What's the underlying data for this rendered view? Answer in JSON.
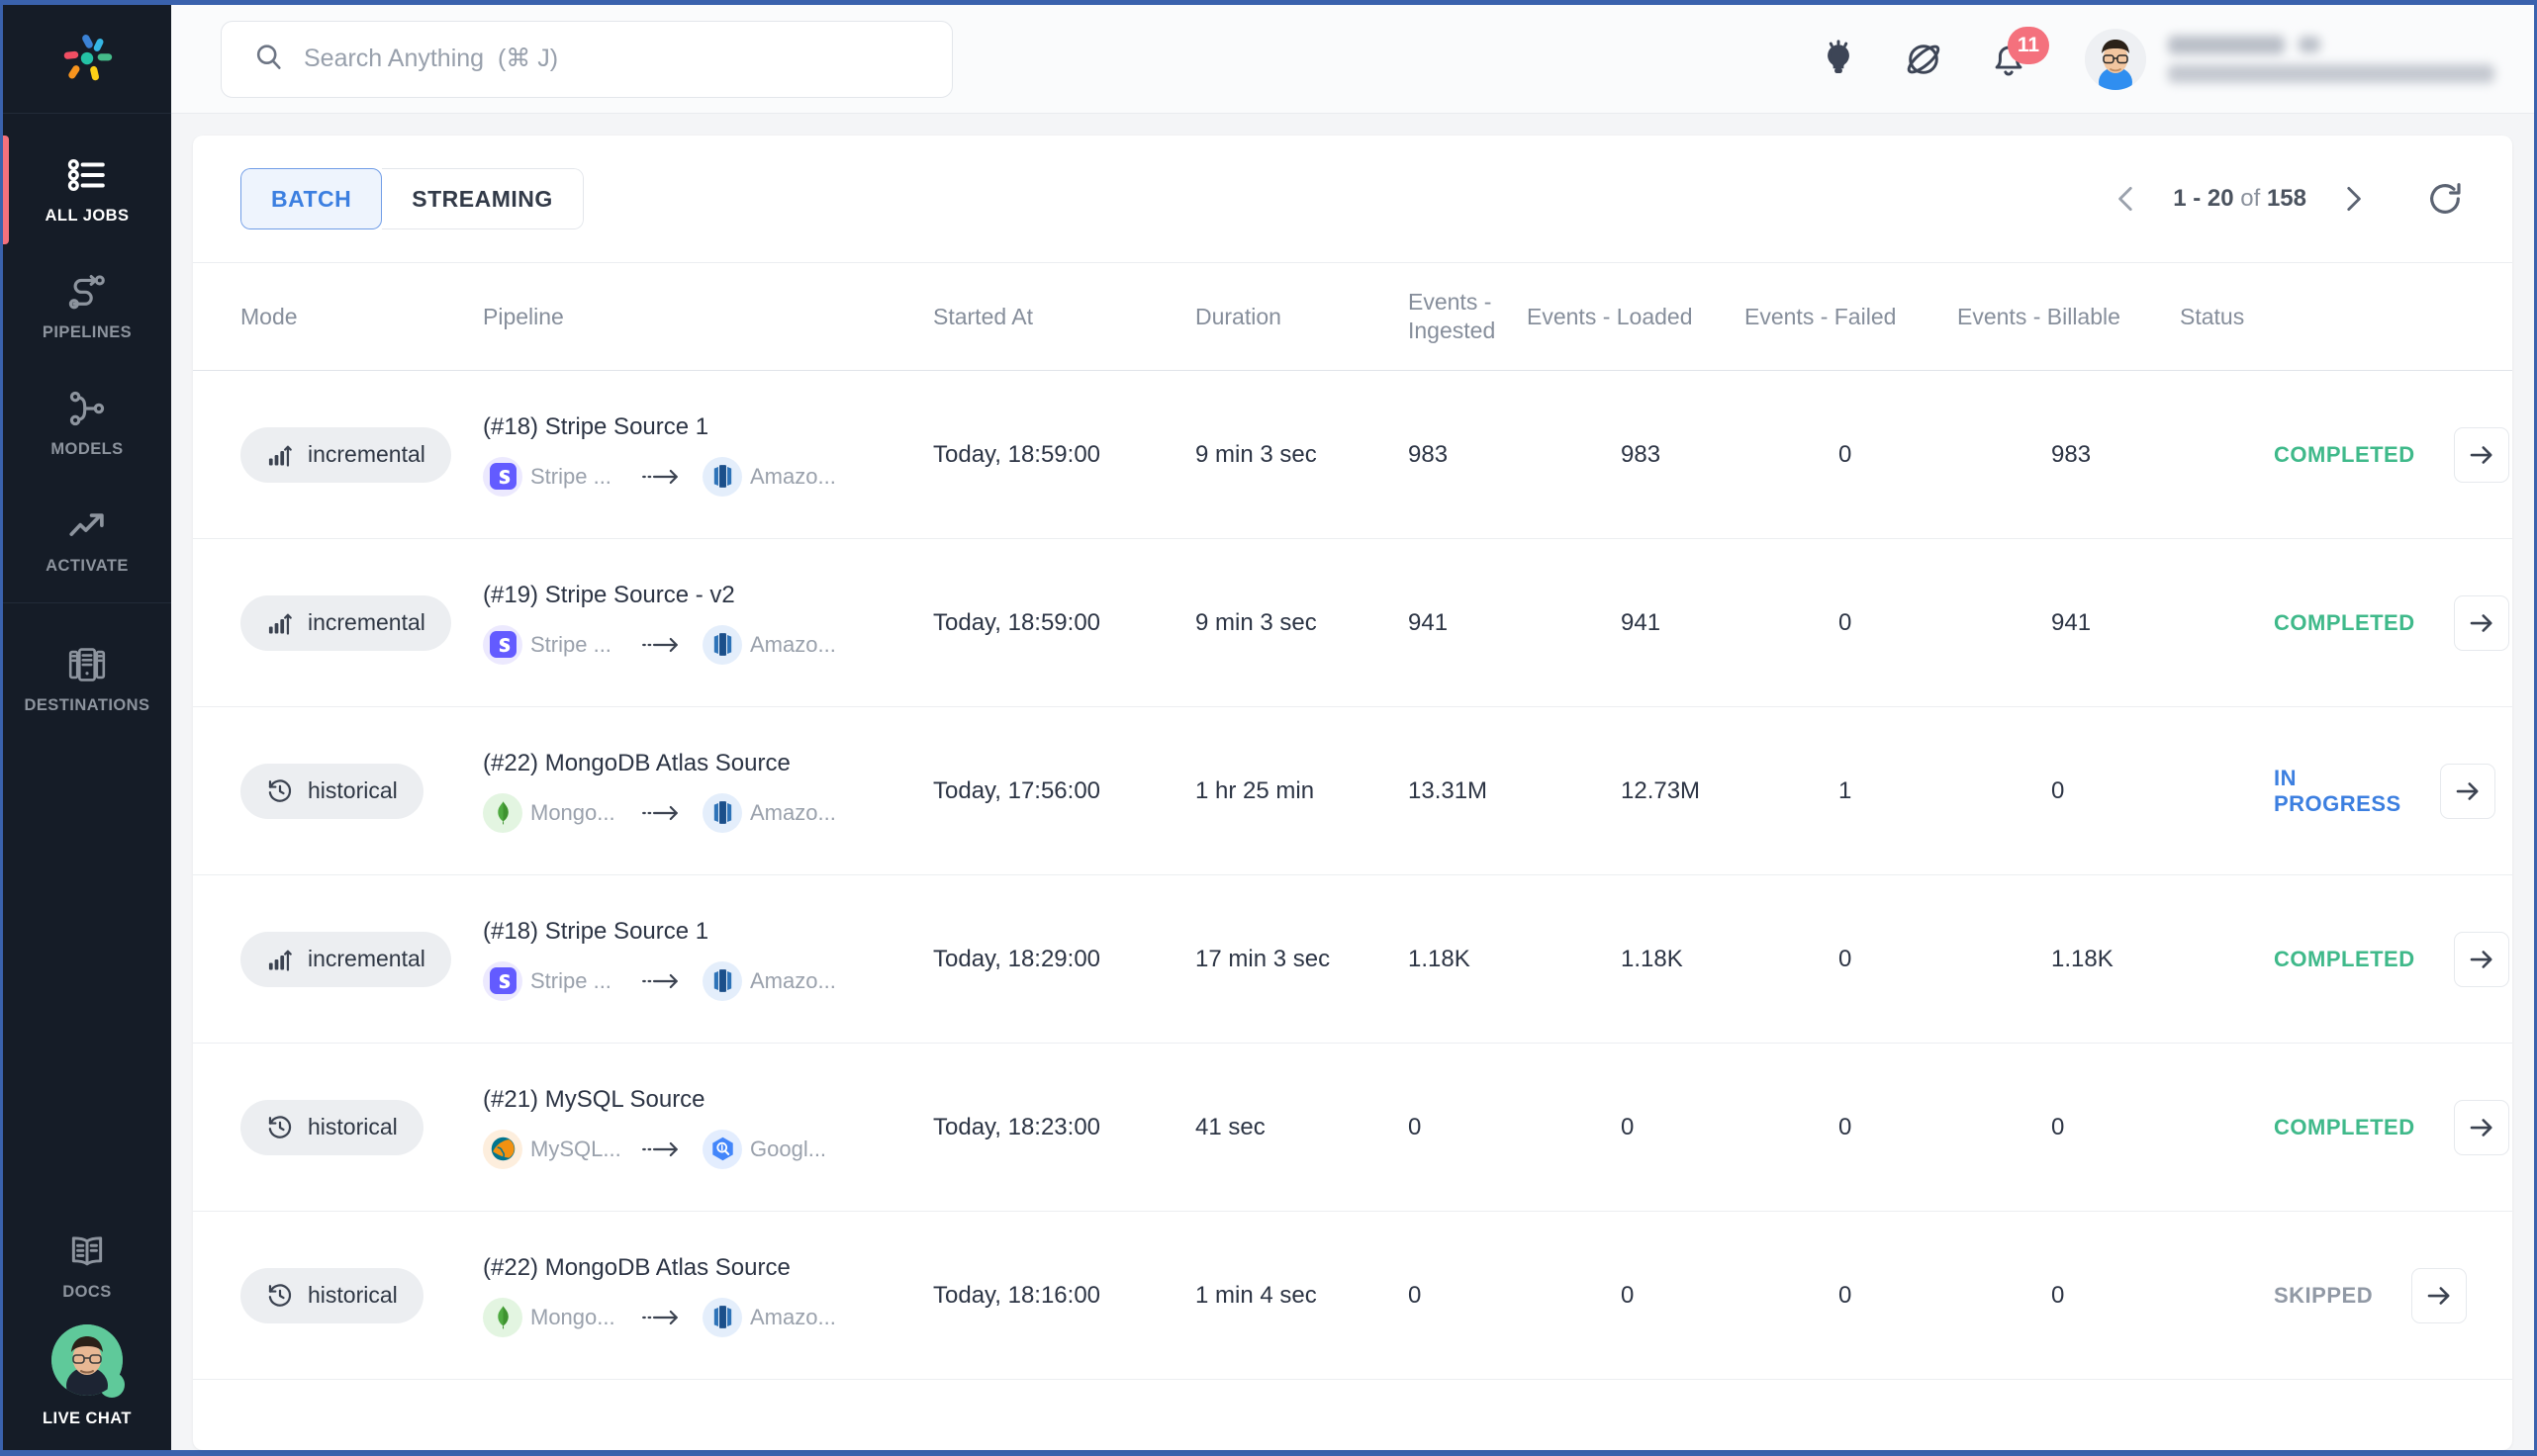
{
  "sidebar": {
    "logo_name": "hevo-logo",
    "items": [
      {
        "label": "ALL JOBS",
        "icon": "list-icon",
        "active": true
      },
      {
        "label": "PIPELINES",
        "icon": "pipeline-icon",
        "active": false
      },
      {
        "label": "MODELS",
        "icon": "models-icon",
        "active": false
      },
      {
        "label": "ACTIVATE",
        "icon": "trending-up-icon",
        "active": false
      },
      {
        "label": "DESTINATIONS",
        "icon": "server-rack-icon",
        "active": false
      },
      {
        "label": "DOCS",
        "icon": "book-icon",
        "active": false
      }
    ],
    "live_chat_label": "LIVE CHAT"
  },
  "topbar": {
    "search_placeholder": "Search Anything  (⌘ J)",
    "search_value": "",
    "icons": [
      {
        "name": "lightbulb-icon"
      },
      {
        "name": "planet-icon"
      },
      {
        "name": "bell-icon",
        "badge": "11"
      }
    ],
    "notification_count": "11",
    "user": {
      "name_redacted": true,
      "email_redacted": true
    }
  },
  "toolbar": {
    "tabs": [
      {
        "label": "BATCH",
        "selected": true
      },
      {
        "label": "STREAMING",
        "selected": false
      }
    ],
    "pagination": {
      "range": "1 - 20",
      "of_label": "of",
      "total": "158"
    },
    "refresh_label": "refresh-icon"
  },
  "table": {
    "columns": [
      {
        "key": "mode",
        "label": "Mode"
      },
      {
        "key": "pipeline",
        "label": "Pipeline"
      },
      {
        "key": "started",
        "label": "Started At"
      },
      {
        "key": "duration",
        "label": "Duration"
      },
      {
        "key": "ingested",
        "label": "Events - Ingested"
      },
      {
        "key": "loaded",
        "label": "Events - Loaded"
      },
      {
        "key": "failed",
        "label": "Events - Failed"
      },
      {
        "key": "billable",
        "label": "Events - Billable"
      },
      {
        "key": "status",
        "label": "Status"
      }
    ],
    "rows": [
      {
        "mode": "incremental",
        "mode_icon": "bar-chart-up-icon",
        "pipeline": "(#18) Stripe Source 1",
        "source": "Stripe ...",
        "source_icon": "stripe-icon",
        "destination": "Amazo...",
        "destination_icon": "amazon-redshift-icon",
        "started": "Today, 18:59:00",
        "duration": "9 min 3 sec",
        "ingested": "983",
        "loaded": "983",
        "failed": "0",
        "billable": "983",
        "status": "COMPLETED",
        "status_kind": "completed"
      },
      {
        "mode": "incremental",
        "mode_icon": "bar-chart-up-icon",
        "pipeline": "(#19) Stripe Source - v2",
        "source": "Stripe ...",
        "source_icon": "stripe-icon",
        "destination": "Amazo...",
        "destination_icon": "amazon-redshift-icon",
        "started": "Today, 18:59:00",
        "duration": "9 min 3 sec",
        "ingested": "941",
        "loaded": "941",
        "failed": "0",
        "billable": "941",
        "status": "COMPLETED",
        "status_kind": "completed"
      },
      {
        "mode": "historical",
        "mode_icon": "history-clock-icon",
        "pipeline": "(#22) MongoDB Atlas Source",
        "source": "Mongo...",
        "source_icon": "mongodb-icon",
        "destination": "Amazo...",
        "destination_icon": "amazon-redshift-icon",
        "started": "Today, 17:56:00",
        "duration": "1 hr 25 min",
        "ingested": "13.31M",
        "loaded": "12.73M",
        "failed": "1",
        "billable": "0",
        "status": "IN PROGRESS",
        "status_kind": "inprogress"
      },
      {
        "mode": "incremental",
        "mode_icon": "bar-chart-up-icon",
        "pipeline": "(#18) Stripe Source 1",
        "source": "Stripe ...",
        "source_icon": "stripe-icon",
        "destination": "Amazo...",
        "destination_icon": "amazon-redshift-icon",
        "started": "Today, 18:29:00",
        "duration": "17 min 3 sec",
        "ingested": "1.18K",
        "loaded": "1.18K",
        "failed": "0",
        "billable": "1.18K",
        "status": "COMPLETED",
        "status_kind": "completed"
      },
      {
        "mode": "historical",
        "mode_icon": "history-clock-icon",
        "pipeline": "(#21) MySQL Source",
        "source": "MySQL...",
        "source_icon": "mysql-icon",
        "destination": "Googl...",
        "destination_icon": "google-bigquery-icon",
        "started": "Today, 18:23:00",
        "duration": "41 sec",
        "ingested": "0",
        "loaded": "0",
        "failed": "0",
        "billable": "0",
        "status": "COMPLETED",
        "status_kind": "completed"
      },
      {
        "mode": "historical",
        "mode_icon": "history-clock-icon",
        "pipeline": "(#22) MongoDB Atlas Source",
        "source": "Mongo...",
        "source_icon": "mongodb-icon",
        "destination": "Amazo...",
        "destination_icon": "amazon-redshift-icon",
        "started": "Today, 18:16:00",
        "duration": "1 min 4 sec",
        "ingested": "0",
        "loaded": "0",
        "failed": "0",
        "billable": "0",
        "status": "SKIPPED",
        "status_kind": "skipped"
      }
    ]
  },
  "colors": {
    "sidebar_bg": "#151c27",
    "active_marker": "#f4717d",
    "accent_blue": "#3c7fe0",
    "status_completed": "#3fb98a",
    "status_inprogress": "#3c7fe0",
    "status_skipped": "#9199a5",
    "badge_red": "#f4717d",
    "live_chat_green": "#5fc99a"
  }
}
